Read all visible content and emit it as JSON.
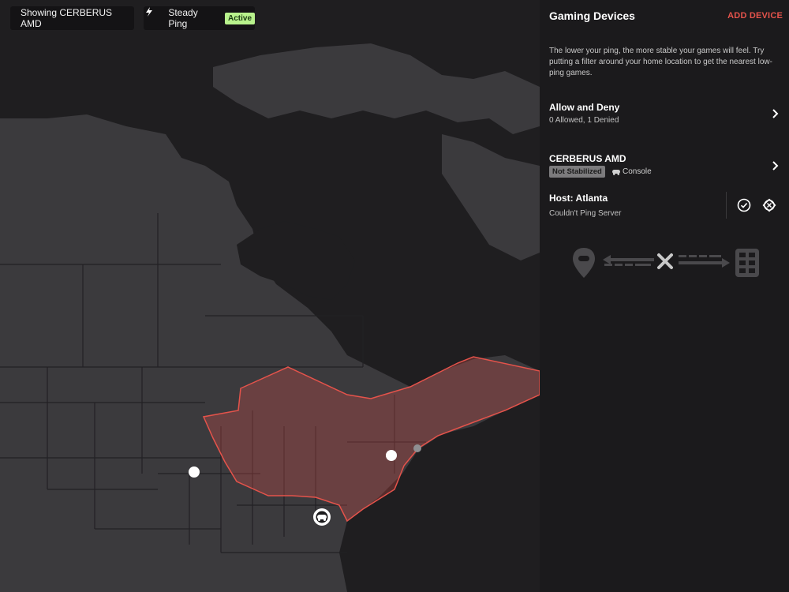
{
  "map": {
    "device_pill": "Showing CERBERUS AMD",
    "ping_pill": {
      "label": "Steady Ping",
      "status": "Active"
    },
    "filter_region_color": "#e5534b",
    "markers": [
      {
        "name": "server-marker-dallas"
      },
      {
        "name": "server-marker-virginia"
      },
      {
        "name": "device-location-atlanta",
        "icon": "gamepad-icon"
      }
    ]
  },
  "panel": {
    "title": "Gaming Devices",
    "add_device": "ADD DEVICE",
    "intro": "The lower your ping, the more stable your games will feel. Try putting a filter around your home location to get the nearest low-ping games.",
    "allow_deny": {
      "title": "Allow and Deny",
      "subtitle": "0 Allowed, 1 Denied"
    },
    "device": {
      "name": "CERBERUS AMD",
      "status": "Not Stabilized",
      "type": "Console"
    },
    "host": {
      "title": "Host: Atlanta",
      "status": "Couldn't Ping Server"
    },
    "diagram": {
      "left_icon": "location-gamepad-icon",
      "middle_icon": "x-icon",
      "right_icon": "server-icon"
    }
  },
  "colors": {
    "accent": "#e5534b",
    "active_badge": "#b8f28c",
    "land": "#3b3a3d",
    "water": "#1f1e20"
  }
}
